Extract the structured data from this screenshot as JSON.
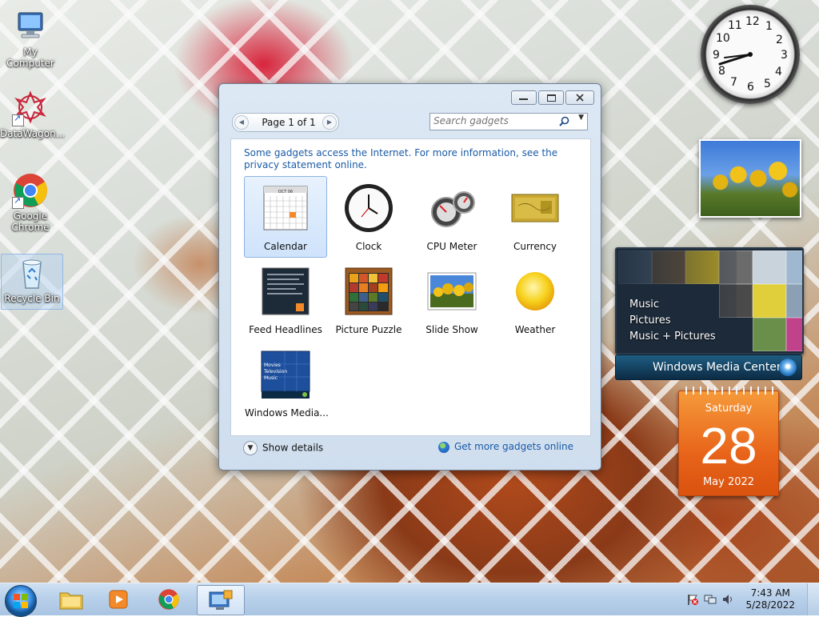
{
  "desktop": {
    "icons": [
      {
        "label": "My Computer"
      },
      {
        "label": "DataWagon..."
      },
      {
        "label": "Google Chrome"
      },
      {
        "label": "Recycle Bin"
      }
    ]
  },
  "desktop_gadgets": {
    "clock_numbers": [
      "12",
      "1",
      "2",
      "3",
      "4",
      "5",
      "6",
      "7",
      "8",
      "9",
      "10",
      "11"
    ],
    "media_center": {
      "items": [
        "Music",
        "Pictures",
        "Music + Pictures"
      ],
      "bar_label_bold": "Windows",
      "bar_label_rest": "Media Center"
    },
    "calendar": {
      "weekday": "Saturday",
      "day": "28",
      "month_year": "May 2022"
    }
  },
  "gadgets_window": {
    "pager_label": "Page 1 of 1",
    "search_placeholder": "Search gadgets",
    "info_text": "Some gadgets access the Internet.  For more information, see the privacy statement online.",
    "gadgets": [
      {
        "name": "Calendar"
      },
      {
        "name": "Clock"
      },
      {
        "name": "CPU Meter"
      },
      {
        "name": "Currency"
      },
      {
        "name": "Feed Headlines"
      },
      {
        "name": "Picture Puzzle"
      },
      {
        "name": "Slide Show"
      },
      {
        "name": "Weather"
      },
      {
        "name": "Windows Media..."
      }
    ],
    "calendar_thumb_month": "OCT 06",
    "wmc_thumb_lines": [
      "Movies",
      "Television",
      "Music"
    ],
    "show_details_label": "Show details",
    "get_more_label": "Get more gadgets online"
  },
  "taskbar": {
    "time": "7:43 AM",
    "date": "5/28/2022"
  },
  "colors": {
    "link": "#1a5ba6",
    "calendar_orange": "#e8641a",
    "taskbar": "#b8d0ea"
  }
}
